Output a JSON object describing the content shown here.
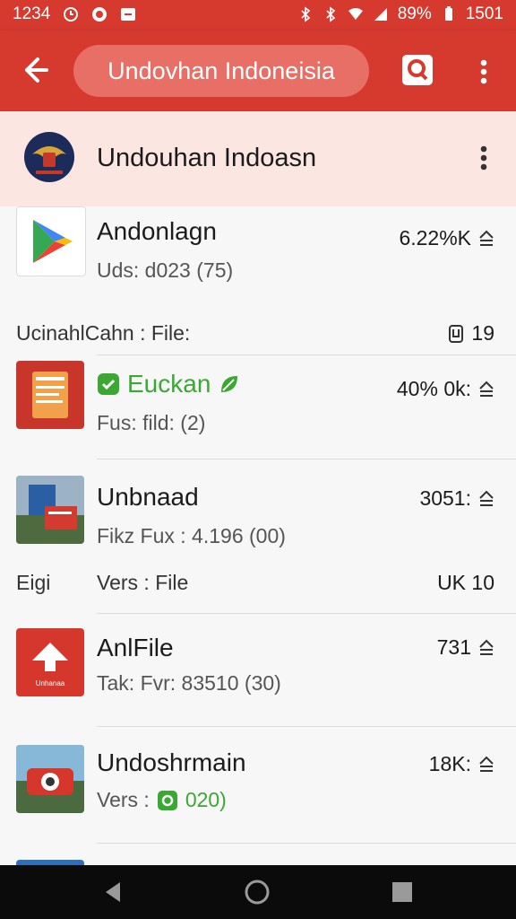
{
  "status_bar": {
    "time": "1234",
    "battery": "89%",
    "clock_right": "1501"
  },
  "app_bar": {
    "search_text": "Undovhan Indoneisia"
  },
  "header": {
    "title": "Undouhan Indoasn"
  },
  "items": [
    {
      "title": "Andonlagn",
      "sub": "Uds: d023 (75)",
      "meta": "6.22%K"
    },
    {
      "caption_left": "UcinahlCahn : File:",
      "caption_right": "19"
    },
    {
      "title": "Euckan",
      "sub": "Fus: fild: (2)",
      "meta": "40% 0k:",
      "verified": true
    },
    {
      "title": "Unbnaad",
      "sub": "Fikz Fux : 4.196 (00)",
      "meta": "3051:"
    },
    {
      "caption_left": "Eigi",
      "caption_mid": "Vers : File",
      "caption_right": "UK 10"
    },
    {
      "title": "AnlFile",
      "sub": "Tak: Fvr: 83510 (30)",
      "meta": "731",
      "thumb_label": "Unhanaa"
    },
    {
      "title": "Undoshrmain",
      "sub_prefix": "Vers :",
      "sub_highlight": "020)",
      "meta": "18K:"
    }
  ],
  "colors": {
    "primary": "#d63a2f",
    "pill": "#e76f66",
    "header_bg": "#fbe6e2",
    "accent_green": "#3aa832"
  }
}
